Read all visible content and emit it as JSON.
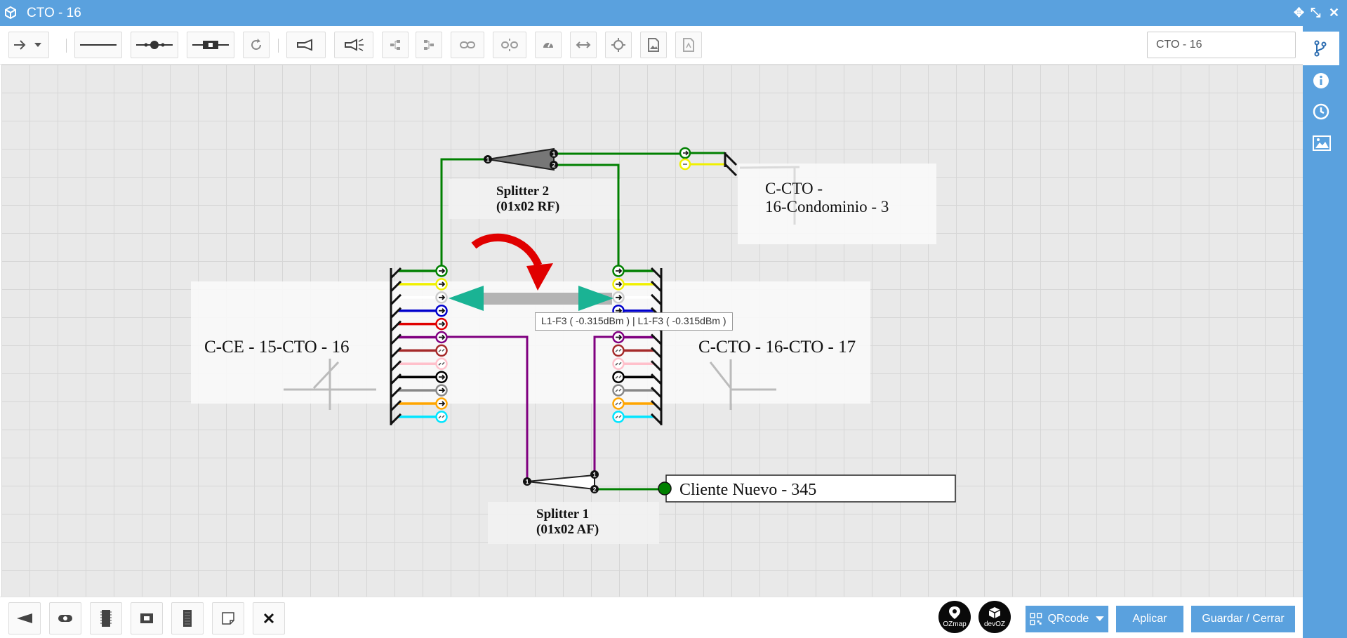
{
  "window": {
    "title": "CTO - 16"
  },
  "toolbar": {
    "name_value": "CTO - 16"
  },
  "diagram": {
    "splitter2_name": "Splitter 2",
    "splitter2_type": "(01x02 RF)",
    "splitter1_name": "Splitter 1",
    "splitter1_type": "(01x02 AF)",
    "cable_left": "C-CE - 15-CTO - 16",
    "cable_right": "C-CTO - 16-CTO - 17",
    "cable_top_line1": "C-CTO -",
    "cable_top_line2": "16-Condominio - 3",
    "client_label": "Cliente Nuevo - 345",
    "port1": "1",
    "port2": "2",
    "tooltip": "L1-F3 ( -0.315dBm ) | L1-F3 ( -0.315dBm )",
    "fiber_colors": [
      "#008000",
      "#f0f000",
      "#ffffff",
      "#0000cc",
      "#e00000",
      "#800080",
      "#a52a2a",
      "#ffc0cb",
      "#000000",
      "#888888",
      "#ffa500",
      "#00e5ff"
    ]
  },
  "bottombar": {
    "logo1": "OZmap",
    "logo2": "devOZ",
    "qrcode_label": "QRcode",
    "apply_label": "Aplicar",
    "save_close_label": "Guardar / Cerrar"
  }
}
